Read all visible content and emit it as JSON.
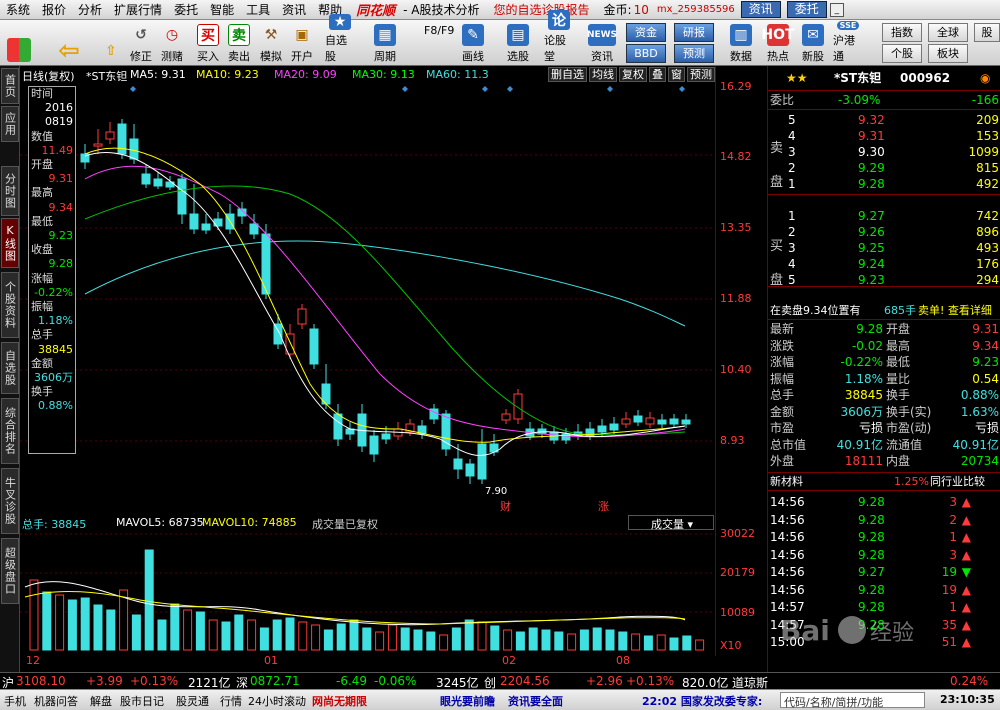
{
  "menubar": {
    "items": [
      "系统",
      "报价",
      "分析",
      "扩展行情",
      "委托",
      "智能",
      "工具",
      "资讯",
      "帮助"
    ],
    "logo": "同花顺",
    "subtitle": "- A股技术分析",
    "promo": "您的自选诊股报告",
    "gold_label": "金币:",
    "gold_value": "10",
    "user": "mx_259385596",
    "btn_news": "资讯",
    "btn_trade": "委托"
  },
  "toolbar": {
    "buttons": [
      "买入",
      "卖出",
      "模拟",
      "开户",
      "自选股",
      "周期",
      "画线",
      "选股",
      "论股堂",
      "资讯",
      "数据",
      "热点",
      "新股",
      "沪港通"
    ],
    "nav": [
      "修正",
      "测赌"
    ],
    "zhouqi_sub": "F8/F9",
    "blue": [
      "资金",
      "研报",
      "BBD",
      "预测"
    ],
    "gray": [
      "指数",
      "全球",
      "股",
      "个股",
      "板块"
    ]
  },
  "lefttabs": [
    "首页",
    "应用",
    "分时图",
    "K线图",
    "个股资料",
    "自选股",
    "综合排名",
    "牛叉诊股",
    "超级盘口"
  ],
  "chart": {
    "period_label": "日线(复权)",
    "stock": "*ST东钽",
    "ma": [
      {
        "label": "MA5: 9.31",
        "color": "#ffffff"
      },
      {
        "label": "MA10: 9.23",
        "color": "#ffff00"
      },
      {
        "label": "MA20: 9.09",
        "color": "#ff40ff"
      },
      {
        "label": "MA30: 9.13",
        "color": "#00ff00"
      },
      {
        "label": "MA60: 11.3",
        "color": "#40e0e0"
      }
    ],
    "buttons": [
      "删自选",
      "均线",
      "复权",
      "叠",
      "窗",
      "预测"
    ],
    "price_axis": [
      "16.29",
      "14.82",
      "13.35",
      "11.88",
      "10.40",
      "8.93"
    ],
    "low_marker": "7.90",
    "markers": [
      "财",
      "涨"
    ]
  },
  "info": {
    "labels": [
      "时间",
      "数值",
      "开盘",
      "最高",
      "最低",
      "收盘",
      "涨幅",
      "振幅",
      "总手",
      "金额",
      "换手"
    ],
    "date1": "2016",
    "date2": "0819",
    "value": "11.49",
    "open": "9.31",
    "high": "9.34",
    "low": "9.23",
    "close": "9.28",
    "change": "-0.22%",
    "amplitude": "1.18%",
    "volume": "38845",
    "amount": "3606万",
    "turnover": "0.88%"
  },
  "volume": {
    "total": "总手: 38845",
    "mavol5": "MAVOL5: 68735",
    "mavol10": "MAVOL10: 74885",
    "note": "成交量已复权",
    "dropdown": "成交量",
    "axis": [
      "30022",
      "20179",
      "10089",
      "X10"
    ]
  },
  "xaxis": [
    "12",
    "01",
    "02",
    "08"
  ],
  "quote": {
    "name": "*ST东钽",
    "code": "000962",
    "weibi_label": "委比",
    "weibi_pct": "-3.09%",
    "weibi_val": "-166",
    "sell_label": "卖盘",
    "buy_label": "买盘",
    "sells": [
      {
        "n": "5",
        "p": "9.32",
        "v": "209"
      },
      {
        "n": "4",
        "p": "9.31",
        "v": "153"
      },
      {
        "n": "3",
        "p": "9.30",
        "v": "1099"
      },
      {
        "n": "2",
        "p": "9.29",
        "v": "815"
      },
      {
        "n": "1",
        "p": "9.28",
        "v": "492"
      }
    ],
    "buys": [
      {
        "n": "1",
        "p": "9.27",
        "v": "742"
      },
      {
        "n": "2",
        "p": "9.26",
        "v": "896"
      },
      {
        "n": "3",
        "p": "9.25",
        "v": "493"
      },
      {
        "n": "4",
        "p": "9.24",
        "v": "176"
      },
      {
        "n": "5",
        "p": "9.23",
        "v": "294"
      }
    ],
    "sellbar": "在卖盘9.34位置有",
    "sellbar_v": "685手",
    "sellbar_link": "卖单! 查看详细",
    "stats": [
      {
        "l1": "最新",
        "v1": "9.28",
        "l2": "开盘",
        "v2": "9.31"
      },
      {
        "l1": "涨跌",
        "v1": "-0.02",
        "l2": "最高",
        "v2": "9.34"
      },
      {
        "l1": "涨幅",
        "v1": "-0.22%",
        "l2": "最低",
        "v2": "9.23"
      },
      {
        "l1": "振幅",
        "v1": "1.18%",
        "l2": "量比",
        "v2": "0.54"
      },
      {
        "l1": "总手",
        "v1": "38845",
        "l2": "换手",
        "v2": "0.88%"
      },
      {
        "l1": "金额",
        "v1": "3606万",
        "l2": "换手(实)",
        "v2": "1.63%"
      },
      {
        "l1": "市盈",
        "v1": "亏损",
        "l2": "市盈(动)",
        "v2": "亏损"
      },
      {
        "l1": "总市值",
        "v1": "40.91亿",
        "l2": "流通值",
        "v2": "40.91亿"
      },
      {
        "l1": "外盘",
        "v1": "18111",
        "l2": "内盘",
        "v2": "20734"
      }
    ],
    "sector": "新材料",
    "sector_pct": "1.25%",
    "compare": "同行业比较",
    "ticks": [
      {
        "t": "14:56",
        "p": "9.28",
        "v": "3",
        "d": "up"
      },
      {
        "t": "14:56",
        "p": "9.28",
        "v": "2",
        "d": "up"
      },
      {
        "t": "14:56",
        "p": "9.28",
        "v": "1",
        "d": "up"
      },
      {
        "t": "14:56",
        "p": "9.28",
        "v": "3",
        "d": "up"
      },
      {
        "t": "14:56",
        "p": "9.27",
        "v": "19",
        "d": "down"
      },
      {
        "t": "14:56",
        "p": "9.28",
        "v": "19",
        "d": "up"
      },
      {
        "t": "14:57",
        "p": "9.28",
        "v": "1",
        "d": "up"
      },
      {
        "t": "14:57",
        "p": "9.28",
        "v": "35",
        "d": "up"
      },
      {
        "t": "15:00",
        "p": "",
        "v": "51",
        "d": "up"
      }
    ]
  },
  "indexbar": {
    "sh_label": "沪",
    "sh": "3108.10",
    "sh_chg": "+3.99",
    "sh_pct": "+0.13%",
    "sh_amt": "2121亿",
    "sz_label": "深",
    "sz": "0872.71",
    "sz_chg": "-6.49",
    "sz_pct": "-0.06%",
    "sz_amt": "3245亿",
    "cy_label": "创",
    "cy": "2204.56",
    "cy_chg": "+2.96",
    "cy_pct": "+0.13%",
    "cy_amt": "820.0亿",
    "last": "道琼斯",
    "last_pct": "0.24%"
  },
  "statusbar": {
    "items": [
      "手机",
      "机器问答",
      "解盘",
      "股市日记",
      "股灵通",
      "行情",
      "24小时滚动"
    ],
    "ad1": "网尚无期限",
    "ad2": "眼光要前瞻",
    "ad3": "资讯要全面",
    "news": "22:02 国家发改委专家:",
    "search": "代码/名称/简拼/功能",
    "time": "23:10:35"
  },
  "watermark": "Baidu经验"
}
